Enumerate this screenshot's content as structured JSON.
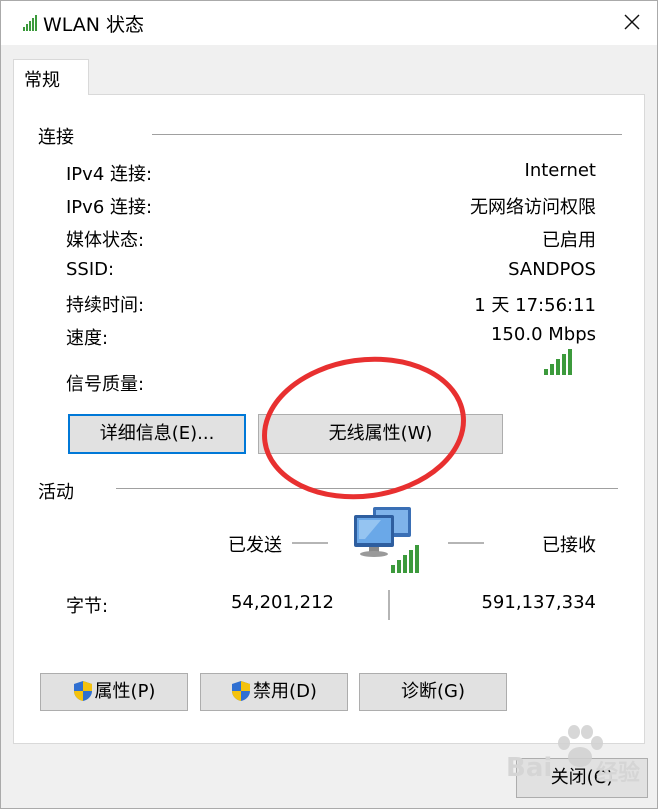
{
  "window": {
    "title": "WLAN 状态",
    "icons": {
      "title": "wifi-signal-icon",
      "close": "close-icon"
    }
  },
  "tabs": [
    {
      "label": "常规",
      "selected": true
    }
  ],
  "connection": {
    "heading": "连接",
    "rows": [
      {
        "label": "IPv4 连接:",
        "value": "Internet"
      },
      {
        "label": "IPv6 连接:",
        "value": "无网络访问权限"
      },
      {
        "label": "媒体状态:",
        "value": "已启用"
      },
      {
        "label": "SSID:",
        "value": "SANDPOS"
      },
      {
        "label": "持续时间:",
        "value": "1 天 17:56:11"
      },
      {
        "label": "速度:",
        "value": "150.0 Mbps"
      }
    ],
    "signal_label": "信号质量:",
    "signal_bars": 5,
    "details_button": "详细信息(E)...",
    "wireless_props_button": "无线属性(W)"
  },
  "activity": {
    "heading": "活动",
    "sent_label": "已发送",
    "received_label": "已接收",
    "bytes_label": "字节:",
    "bytes_sent": "54,201,212",
    "bytes_received": "591,137,334",
    "icon": "network-computers-icon"
  },
  "buttons": {
    "properties": "属性(P)",
    "disable": "禁用(D)",
    "diagnose": "诊断(G)",
    "close": "关闭(C)"
  },
  "watermark": {
    "brand": "Bai",
    "suffix": "经验"
  },
  "colors": {
    "accent": "#0078d7",
    "signal": "#3c9a3c",
    "annotation": "#e83030"
  }
}
